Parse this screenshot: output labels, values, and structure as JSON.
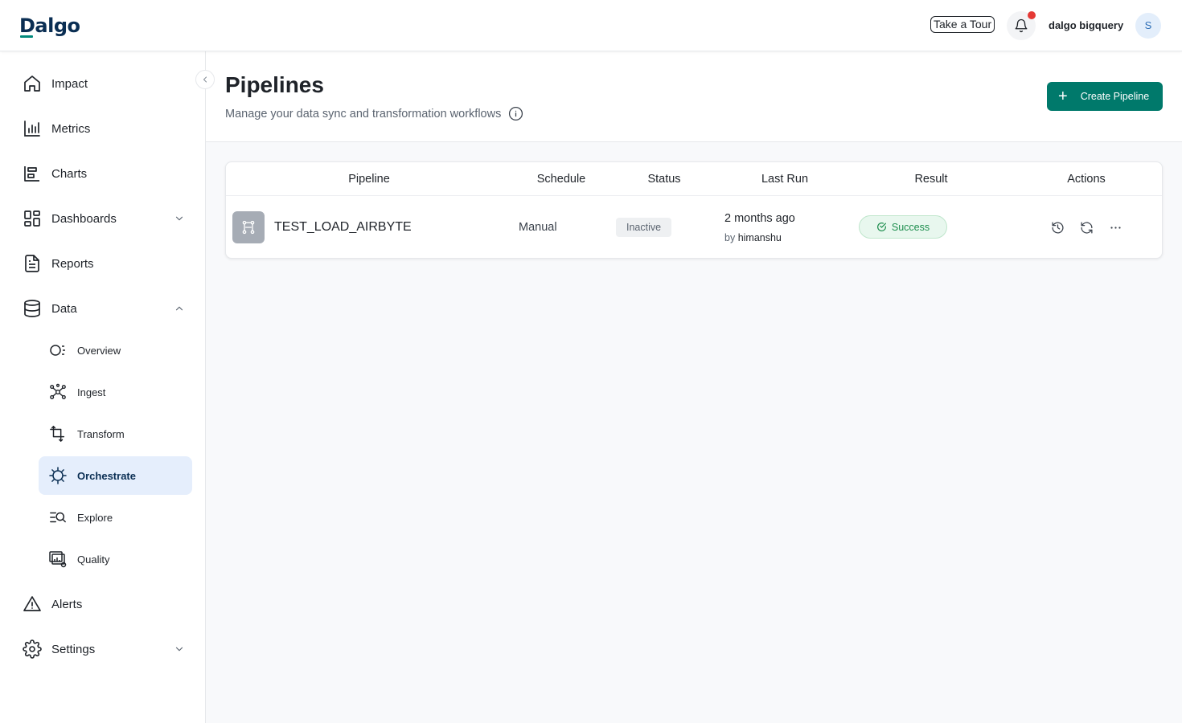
{
  "header": {
    "logo": "Dalgo",
    "tour_label": "Take a Tour",
    "user_name": "dalgo bigquery",
    "avatar_initial": "S",
    "accent": "#00796b",
    "notification_dot_color": "#e53935"
  },
  "sidebar": {
    "items": [
      {
        "label": "Impact",
        "icon": "home-icon"
      },
      {
        "label": "Metrics",
        "icon": "bar-chart-icon"
      },
      {
        "label": "Charts",
        "icon": "chart-icon"
      },
      {
        "label": "Dashboards",
        "icon": "dashboard-icon",
        "expandable": true
      },
      {
        "label": "Reports",
        "icon": "document-icon"
      },
      {
        "label": "Data",
        "icon": "database-icon",
        "expandable": true,
        "expanded": true
      },
      {
        "label": "Alerts",
        "icon": "warning-icon"
      },
      {
        "label": "Settings",
        "icon": "gear-icon",
        "expandable": true
      }
    ],
    "data_children": [
      {
        "label": "Overview",
        "icon": "overview-icon"
      },
      {
        "label": "Ingest",
        "icon": "ingest-icon"
      },
      {
        "label": "Transform",
        "icon": "transform-icon"
      },
      {
        "label": "Orchestrate",
        "icon": "orchestrate-icon",
        "active": true
      },
      {
        "label": "Explore",
        "icon": "explore-icon"
      },
      {
        "label": "Quality",
        "icon": "quality-icon"
      }
    ]
  },
  "page": {
    "title": "Pipelines",
    "subtitle": "Manage your data sync and transformation workflows",
    "create_button": "Create Pipeline"
  },
  "table": {
    "columns": [
      "Pipeline",
      "Schedule",
      "Status",
      "Last Run",
      "Result",
      "Actions"
    ],
    "rows": [
      {
        "name": "TEST_LOAD_AIRBYTE",
        "schedule": "Manual",
        "status": "Inactive",
        "last_run": "2 months ago",
        "by_prefix": "by",
        "by_user": "himanshu",
        "result": "Success",
        "actions": [
          "history-icon",
          "sync-icon",
          "more-icon"
        ]
      }
    ]
  }
}
